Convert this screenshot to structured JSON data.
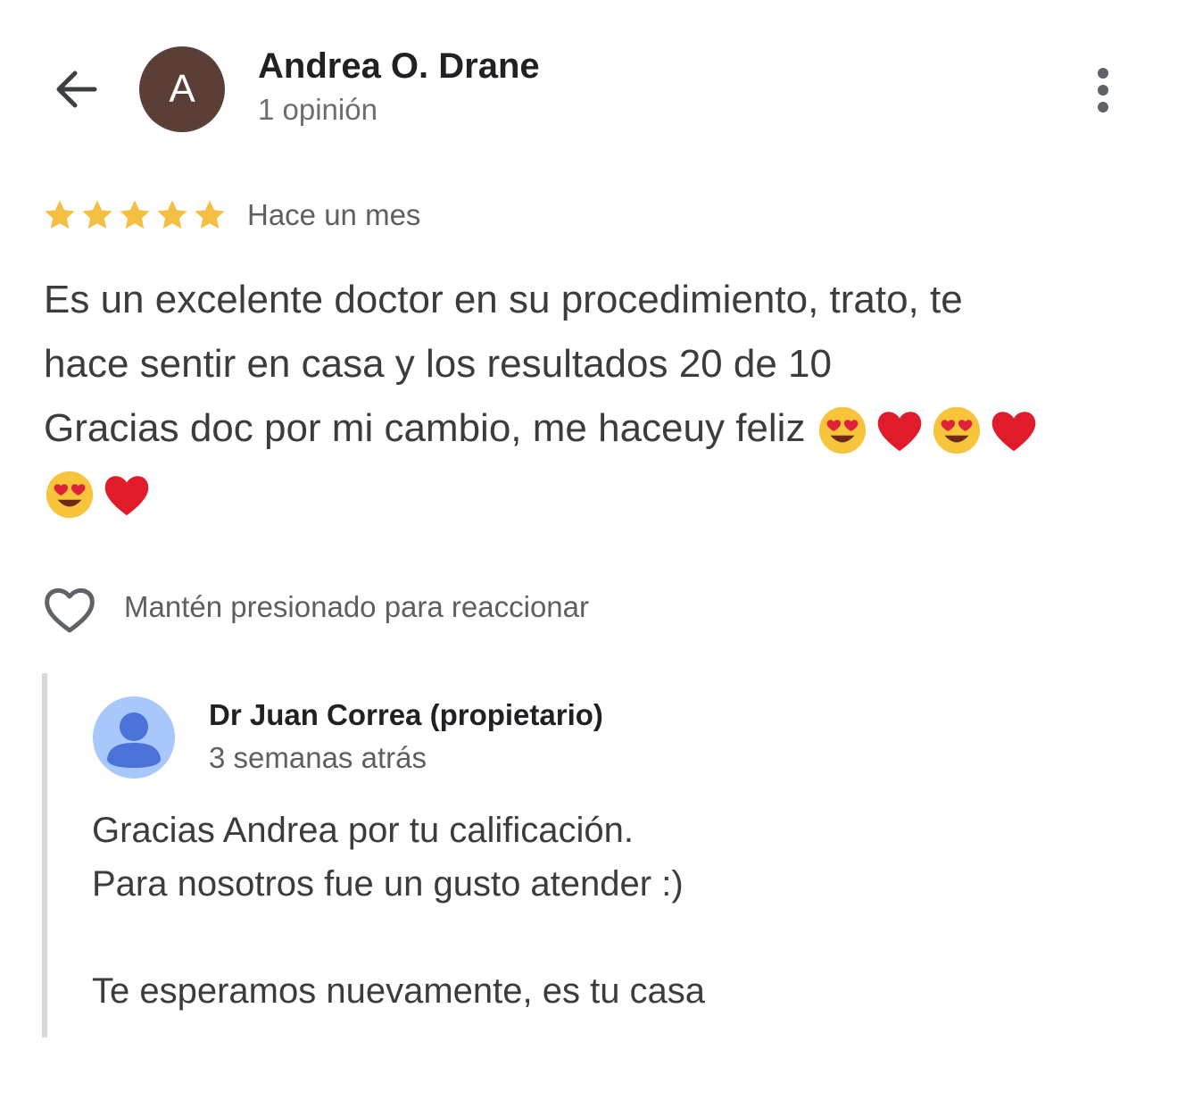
{
  "header": {
    "back_icon": "arrow-back-icon",
    "avatar_letter": "A",
    "avatar_color": "#5b3f37",
    "reviewer_name": "Andrea O. Drane",
    "review_count": "1 opinión",
    "more_icon": "more-vert-icon"
  },
  "rating": {
    "stars": 5,
    "max_stars": 5,
    "star_color": "#f4bf42",
    "date": "Hace un mes"
  },
  "review": {
    "lines": [
      "Es un excelente doctor en su procedimiento, trato, te",
      "hace sentir en casa y los resultados 20 de 10",
      "Gracias doc por mi cambio, me haceuy feliz"
    ],
    "emojis": [
      "😍",
      "❤️",
      "😍",
      "❤️",
      "😍",
      "❤️"
    ]
  },
  "reaction": {
    "heart_icon": "heart-outline-icon",
    "hint": "Mantén presionado para reaccionar"
  },
  "owner_reply": {
    "avatar_icon": "person-avatar-icon",
    "name": "Dr Juan Correa (propietario)",
    "date": "3 semanas atrás",
    "lines": [
      "Gracias Andrea por tu calificación.",
      "Para nosotros fue un gusto atender :)",
      "",
      "Te esperamos nuevamente, es tu casa"
    ]
  }
}
